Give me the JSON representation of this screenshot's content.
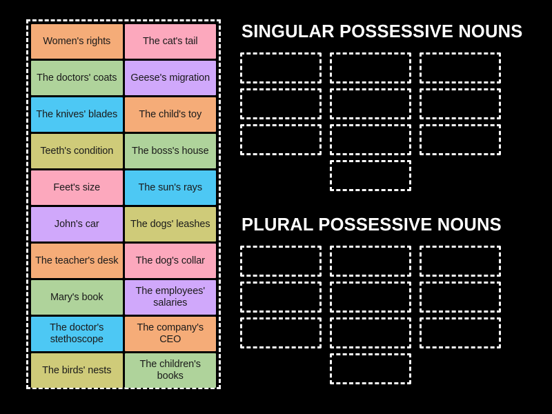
{
  "page": {
    "background_color": "#000000",
    "activity_type": "group-sort"
  },
  "tile_tray": {
    "name": "word-tile-tray",
    "border_color": "#ffffff",
    "tiles": [
      {
        "label": "Women's rights",
        "color": "#F5AC78"
      },
      {
        "label": "The cat's tail",
        "color": "#FCA8BD"
      },
      {
        "label": "The doctors' coats",
        "color": "#AFD39B"
      },
      {
        "label": "Geese's migration",
        "color": "#D0A8FB"
      },
      {
        "label": "The knives' blades",
        "color": "#4DC8F4"
      },
      {
        "label": "The child's toy",
        "color": "#F5AC78"
      },
      {
        "label": "Teeth's condition",
        "color": "#CFCB79"
      },
      {
        "label": "The boss's house",
        "color": "#AFD39B"
      },
      {
        "label": "Feet's size",
        "color": "#FCA8BD"
      },
      {
        "label": "The sun's rays",
        "color": "#4DC8F4"
      },
      {
        "label": "John's car",
        "color": "#D0A8FB"
      },
      {
        "label": "The dogs' leashes",
        "color": "#CFCB79"
      },
      {
        "label": "The teacher's desk",
        "color": "#F5AC78"
      },
      {
        "label": "The dog's collar",
        "color": "#FCA8BD"
      },
      {
        "label": "Mary's book",
        "color": "#AFD39B"
      },
      {
        "label": "The employees' salaries",
        "color": "#D0A8FB"
      },
      {
        "label": "The doctor's stethoscope",
        "color": "#4DC8F4"
      },
      {
        "label": "The company's CEO",
        "color": "#F5AC78"
      },
      {
        "label": "The birds' nests",
        "color": "#CFCB79"
      },
      {
        "label": "The children's books",
        "color": "#AFD39B"
      }
    ]
  },
  "categories": [
    {
      "title": "SINGULAR POSSESSIVE NOUNS",
      "title_color": "#ffffff",
      "dropzone_count": 10,
      "dropzone_layout": "3-3-3-1",
      "dropzones": [
        "",
        "",
        "",
        "",
        "",
        "",
        "",
        "",
        "",
        ""
      ]
    },
    {
      "title": "PLURAL POSSESSIVE NOUNS",
      "title_color": "#ffffff",
      "dropzone_count": 10,
      "dropzone_layout": "3-3-3-1",
      "dropzones": [
        "",
        "",
        "",
        "",
        "",
        "",
        "",
        "",
        "",
        ""
      ]
    }
  ]
}
